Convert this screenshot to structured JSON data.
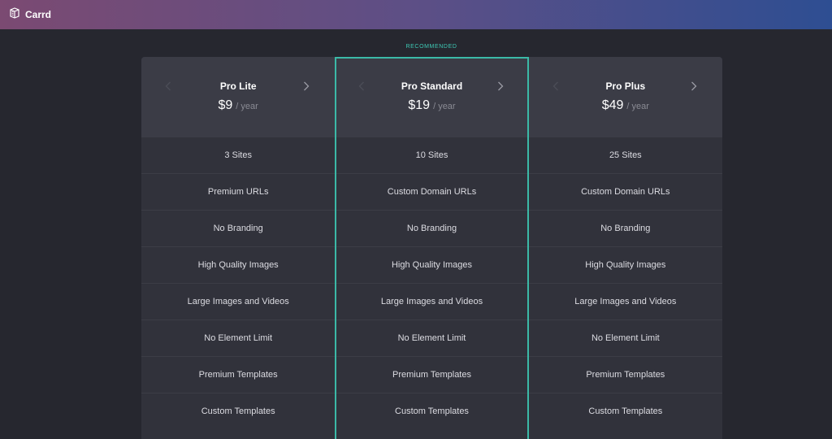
{
  "app": {
    "name": "Carrd"
  },
  "recommended_label": "RECOMMENDED",
  "colors": {
    "accent": "#3bb9a7",
    "header_gradient": [
      "#7b4a72",
      "#2e4e92"
    ]
  },
  "icons": {
    "logo": "carrd-logo-icon",
    "prev": "chevron-left-icon",
    "next": "chevron-right-icon"
  },
  "plans": [
    {
      "name": "Pro Lite",
      "price": "$9",
      "period": "/ year",
      "features": [
        "3 Sites",
        "Premium URLs",
        "No Branding",
        "High Quality Images",
        "Large Images and Videos",
        "No Element Limit",
        "Premium Templates",
        "Custom Templates"
      ]
    },
    {
      "name": "Pro Standard",
      "price": "$19",
      "period": "/ year",
      "features": [
        "10 Sites",
        "Custom Domain URLs",
        "No Branding",
        "High Quality Images",
        "Large Images and Videos",
        "No Element Limit",
        "Premium Templates",
        "Custom Templates"
      ]
    },
    {
      "name": "Pro Plus",
      "price": "$49",
      "period": "/ year",
      "features": [
        "25 Sites",
        "Custom Domain URLs",
        "No Branding",
        "High Quality Images",
        "Large Images and Videos",
        "No Element Limit",
        "Premium Templates",
        "Custom Templates"
      ]
    }
  ]
}
